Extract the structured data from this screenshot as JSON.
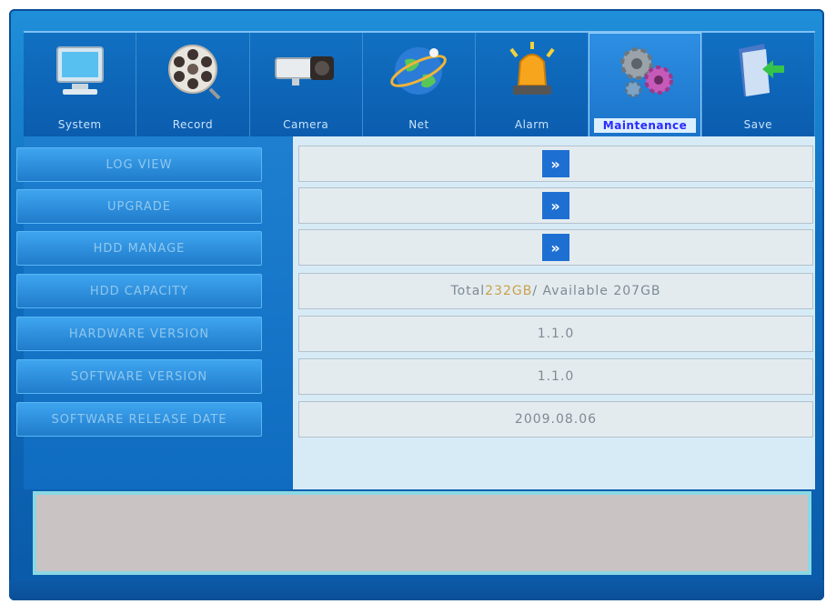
{
  "tabs": [
    {
      "label": "System",
      "icon": "monitor-icon"
    },
    {
      "label": "Record",
      "icon": "film-reel-icon"
    },
    {
      "label": "Camera",
      "icon": "camera-icon"
    },
    {
      "label": "Net",
      "icon": "globe-icon"
    },
    {
      "label": "Alarm",
      "icon": "alarm-siren-icon"
    },
    {
      "label": "Maintenance",
      "icon": "gears-icon"
    },
    {
      "label": "Save",
      "icon": "save-icon"
    }
  ],
  "active_tab": "Maintenance",
  "rows": [
    {
      "label": "LOG VIEW",
      "value": "",
      "action": "»"
    },
    {
      "label": "UPGRADE",
      "value": "",
      "action": "»"
    },
    {
      "label": "HDD MANAGE",
      "value": "",
      "action": "»"
    },
    {
      "label": "HDD CAPACITY",
      "value_prefix": "Total ",
      "value_highlight": "232GB",
      "value_suffix": " / Available 207GB"
    },
    {
      "label": "HARDWARE VERSION",
      "value": "1.1.0"
    },
    {
      "label": "SOFTWARE VERSION",
      "value": "1.1.0"
    },
    {
      "label": "SOFTWARE RELEASE DATE",
      "value": "2009.08.06"
    }
  ],
  "colors": {
    "accent": "#1d6fd2",
    "panel": "#0f6cc0",
    "field": "#e4ebef"
  }
}
